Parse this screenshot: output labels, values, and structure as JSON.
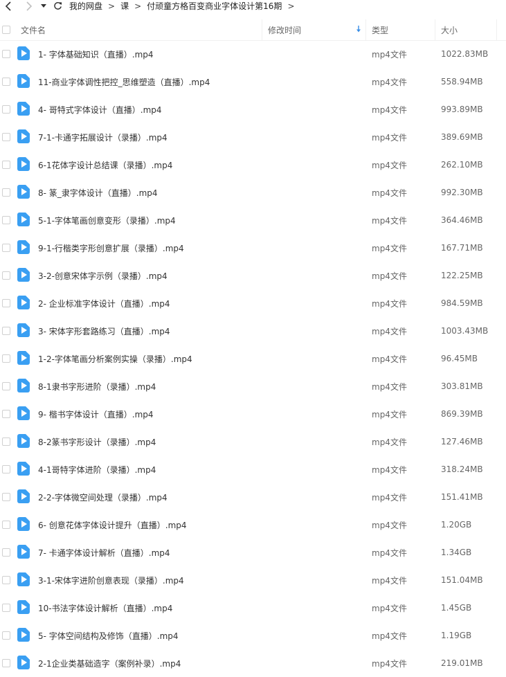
{
  "nav": {
    "breadcrumbs": [
      "我的网盘",
      "课",
      "付顽童方格百变商业字体设计第16期"
    ],
    "separator": ">"
  },
  "header": {
    "name": "文件名",
    "mtime": "修改时间",
    "type": "类型",
    "size": "大小"
  },
  "colors": {
    "accent": "#3a8ee6",
    "video_icon": "#3a9ff2"
  },
  "files": [
    {
      "name": "1- 字体基础知识（直播）.mp4",
      "type": "mp4文件",
      "size": "1022.83MB"
    },
    {
      "name": "11-商业字体调性把控_思维塑造（直播）.mp4",
      "type": "mp4文件",
      "size": "558.94MB"
    },
    {
      "name": "4- 哥特式字体设计（直播）.mp4",
      "type": "mp4文件",
      "size": "993.89MB"
    },
    {
      "name": "7-1-卡通字拓展设计（录播）.mp4",
      "type": "mp4文件",
      "size": "389.69MB"
    },
    {
      "name": "6-1花体字设计总结课（录播）.mp4",
      "type": "mp4文件",
      "size": "262.10MB"
    },
    {
      "name": "8- 篆_隶字体设计（直播）.mp4",
      "type": "mp4文件",
      "size": "992.30MB"
    },
    {
      "name": "5-1-字体笔画创意变形（录播）.mp4",
      "type": "mp4文件",
      "size": "364.46MB"
    },
    {
      "name": "9-1-行楷类字形创意扩展（录播）.mp4",
      "type": "mp4文件",
      "size": "167.71MB"
    },
    {
      "name": "3-2-创意宋体字示例（录播）.mp4",
      "type": "mp4文件",
      "size": "122.25MB"
    },
    {
      "name": "2- 企业标准字体设计（直播）.mp4",
      "type": "mp4文件",
      "size": "984.59MB"
    },
    {
      "name": "3- 宋体字形套路练习（直播）.mp4",
      "type": "mp4文件",
      "size": "1003.43MB"
    },
    {
      "name": "1-2-字体笔画分析案例实操（录播）.mp4",
      "type": "mp4文件",
      "size": "96.45MB"
    },
    {
      "name": "8-1隶书字形进阶（录播）.mp4",
      "type": "mp4文件",
      "size": "303.81MB"
    },
    {
      "name": "9- 楷书字体设计（直播）.mp4",
      "type": "mp4文件",
      "size": "869.39MB"
    },
    {
      "name": "8-2篆书字形设计（录播）.mp4",
      "type": "mp4文件",
      "size": "127.46MB"
    },
    {
      "name": "4-1哥特字体进阶（录播）.mp4",
      "type": "mp4文件",
      "size": "318.24MB"
    },
    {
      "name": "2-2-字体微空间处理（录播）.mp4",
      "type": "mp4文件",
      "size": "151.41MB"
    },
    {
      "name": "6- 创意花体字体设计提升（直播）.mp4",
      "type": "mp4文件",
      "size": "1.20GB"
    },
    {
      "name": "7- 卡通字体设计解析（直播）.mp4",
      "type": "mp4文件",
      "size": "1.34GB"
    },
    {
      "name": "3-1-宋体字进阶创意表现（录播）.mp4",
      "type": "mp4文件",
      "size": "151.04MB"
    },
    {
      "name": "10-书法字体设计解析（直播）.mp4",
      "type": "mp4文件",
      "size": "1.45GB"
    },
    {
      "name": "5- 字体空间结构及修饰（直播）.mp4",
      "type": "mp4文件",
      "size": "1.19GB"
    },
    {
      "name": "2-1企业类基础造字（案例补录）.mp4",
      "type": "mp4文件",
      "size": "219.01MB"
    }
  ]
}
